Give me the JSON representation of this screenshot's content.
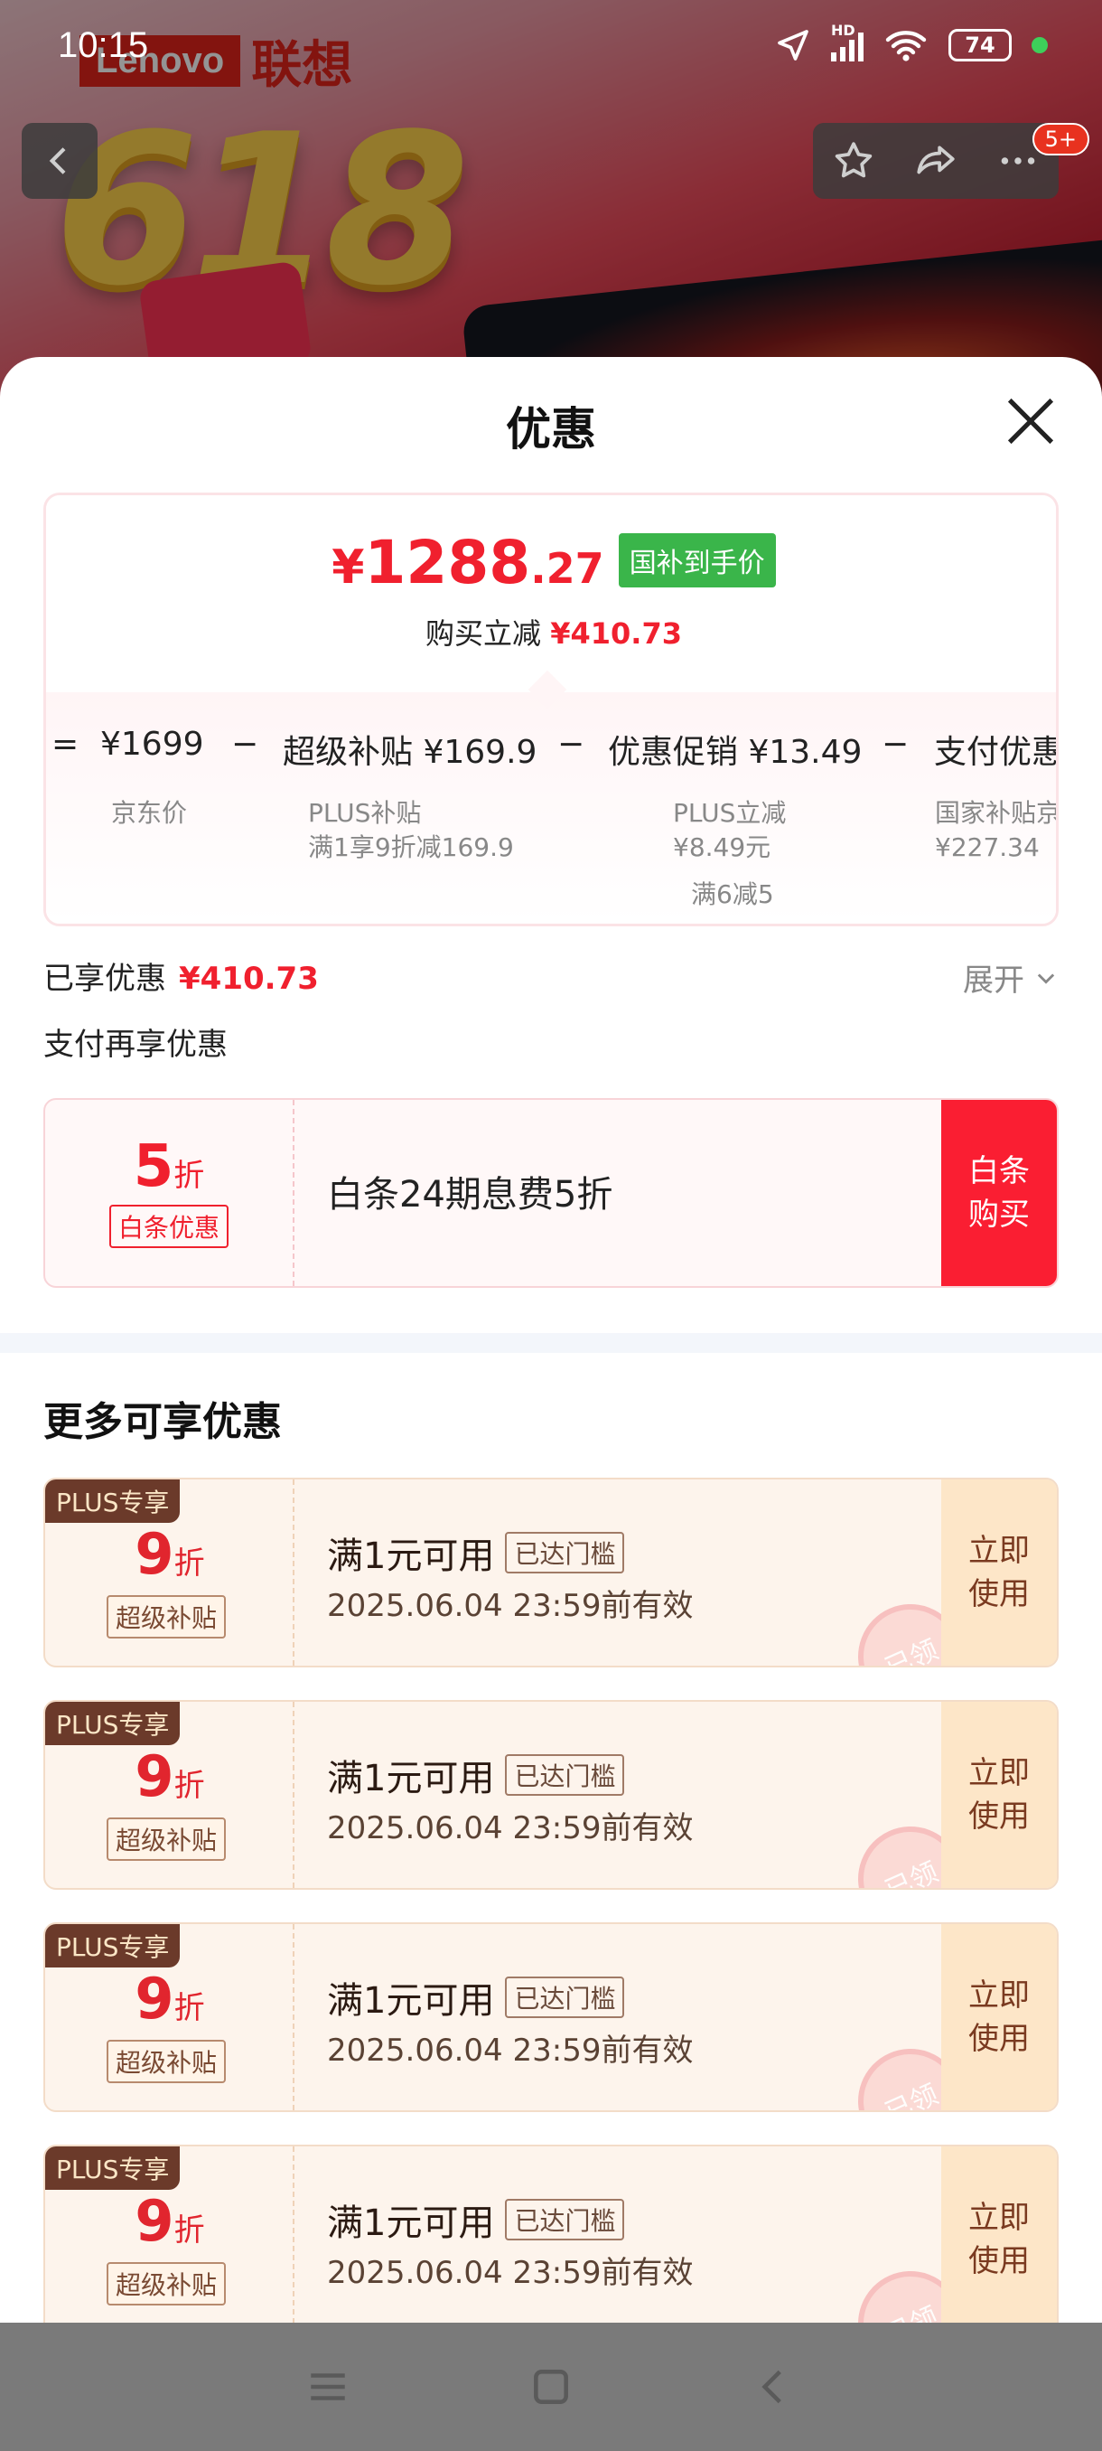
{
  "status_bar": {
    "time": "10:15",
    "network_label": "HD",
    "battery": "74"
  },
  "banner": {
    "brand_en": "Lenovo",
    "brand_cn": "联想",
    "promo_number": "618",
    "notification_count": "5+"
  },
  "sheet": {
    "title": "优惠"
  },
  "price_card": {
    "final_price_symbol": "¥",
    "final_price_int": "1288",
    "final_price_dec": ".27",
    "price_tag": "国补到手价",
    "instant_discount_label": "购买立减",
    "instant_discount_value": "¥410.73",
    "calc": {
      "eq": "=",
      "jd_price": "¥1699",
      "minus1": "−",
      "subsidy_label": "超级补贴",
      "subsidy_value": "¥169.9",
      "minus2": "−",
      "promo_label": "优惠促销",
      "promo_value": "¥13.49",
      "minus3": "−",
      "pay_label": "支付优惠"
    },
    "sub": {
      "jd_price_label": "京东价",
      "plus_subsidy_title": "PLUS补贴",
      "plus_subsidy_desc": "满1享9折减169.9",
      "plus_discount_title": "PLUS立减",
      "plus_discount_value": "¥8.49元",
      "full_reduction": "满6减5",
      "national_subsidy_title": "国家补贴京",
      "national_subsidy_value": "¥227.34"
    }
  },
  "enjoyed": {
    "label": "已享优惠",
    "value": "¥410.73",
    "expand_label": "展开"
  },
  "pay_more": {
    "label": "支付再享优惠"
  },
  "baitiao": {
    "discount_num": "5",
    "discount_unit": "折",
    "tag": "白条优惠",
    "title": "白条24期息费5折",
    "button_line1": "白条",
    "button_line2": "购买"
  },
  "more": {
    "title": "更多可享优惠",
    "coupons": [
      {
        "plus_tag": "PLUS专享",
        "discount_num": "9",
        "discount_unit": "折",
        "label": "超级补贴",
        "title": "满1元可用",
        "threshold_tag": "已达门槛",
        "validity": "2025.06.04 23:59前有效",
        "button_line1": "立即",
        "button_line2": "使用",
        "stamp": "已领"
      },
      {
        "plus_tag": "PLUS专享",
        "discount_num": "9",
        "discount_unit": "折",
        "label": "超级补贴",
        "title": "满1元可用",
        "threshold_tag": "已达门槛",
        "validity": "2025.06.04 23:59前有效",
        "button_line1": "立即",
        "button_line2": "使用",
        "stamp": "已领"
      },
      {
        "plus_tag": "PLUS专享",
        "discount_num": "9",
        "discount_unit": "折",
        "label": "超级补贴",
        "title": "满1元可用",
        "threshold_tag": "已达门槛",
        "validity": "2025.06.04 23:59前有效",
        "button_line1": "立即",
        "button_line2": "使用",
        "stamp": "已领"
      },
      {
        "plus_tag": "PLUS专享",
        "discount_num": "9",
        "discount_unit": "折",
        "label": "超级补贴",
        "title": "满1元可用",
        "threshold_tag": "已达门槛",
        "validity": "2025.06.04 23:59前有效",
        "button_line1": "立即",
        "button_line2": "使用",
        "stamp": "已领"
      }
    ]
  }
}
